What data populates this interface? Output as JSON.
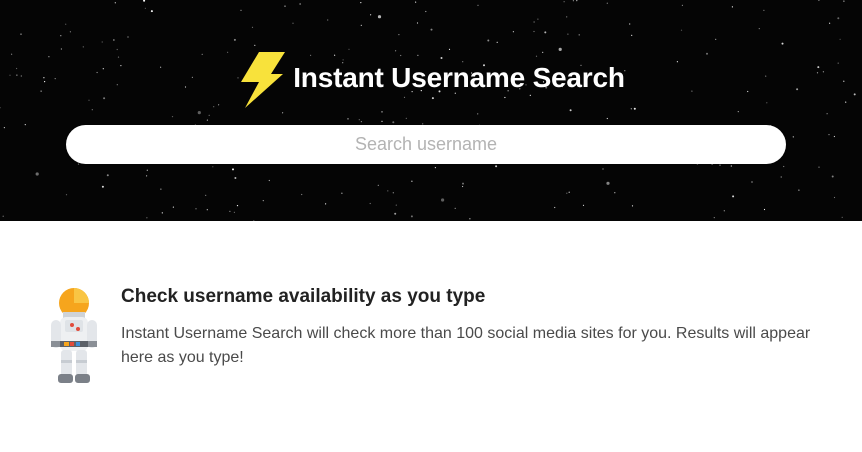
{
  "header": {
    "title": "Instant Username Search",
    "logo_icon": "lightning-bolt-icon",
    "background_color": "#050505",
    "bolt_color": "#f8e23b"
  },
  "search": {
    "placeholder": "Search username",
    "value": ""
  },
  "intro": {
    "icon": "astronaut-icon",
    "heading": "Check username availability as you type",
    "body": "Instant Username Search will check more than 100 social media sites for you. Results will appear here as you type!"
  }
}
